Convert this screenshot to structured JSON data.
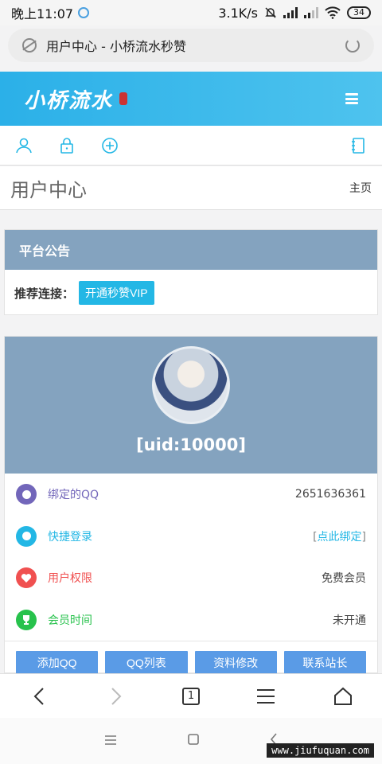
{
  "status_bar": {
    "time": "晚上11:07",
    "speed": "3.1K/s",
    "battery": "34"
  },
  "browser": {
    "url_title": "用户中心 - 小桥流水秒赞",
    "tab_count": "1"
  },
  "site": {
    "logo_text": "小桥流水"
  },
  "page": {
    "title": "用户中心",
    "breadcrumb": "主页"
  },
  "announcement": {
    "heading": "平台公告",
    "link_label": "推荐连接：",
    "vip_button": "开通秒赞VIP"
  },
  "user": {
    "uid": "[uid:10000]",
    "rows": [
      {
        "name": "绑定的QQ",
        "value": "2651636361"
      },
      {
        "name": "快捷登录",
        "value_open": "[",
        "value": "点此绑定",
        "value_close": "]"
      },
      {
        "name": "用户权限",
        "value": "免费会员"
      },
      {
        "name": "会员时间",
        "value": "未开通"
      }
    ],
    "actions": [
      "添加QQ",
      "QQ列表",
      "资料修改",
      "联系站长"
    ]
  },
  "watermark": "www.jiufuquan.com",
  "colors": {
    "header": "#2bb0e8",
    "panel_heading": "#84a3bf",
    "accent": "#23b7e5",
    "action_button": "#5a9be6"
  }
}
